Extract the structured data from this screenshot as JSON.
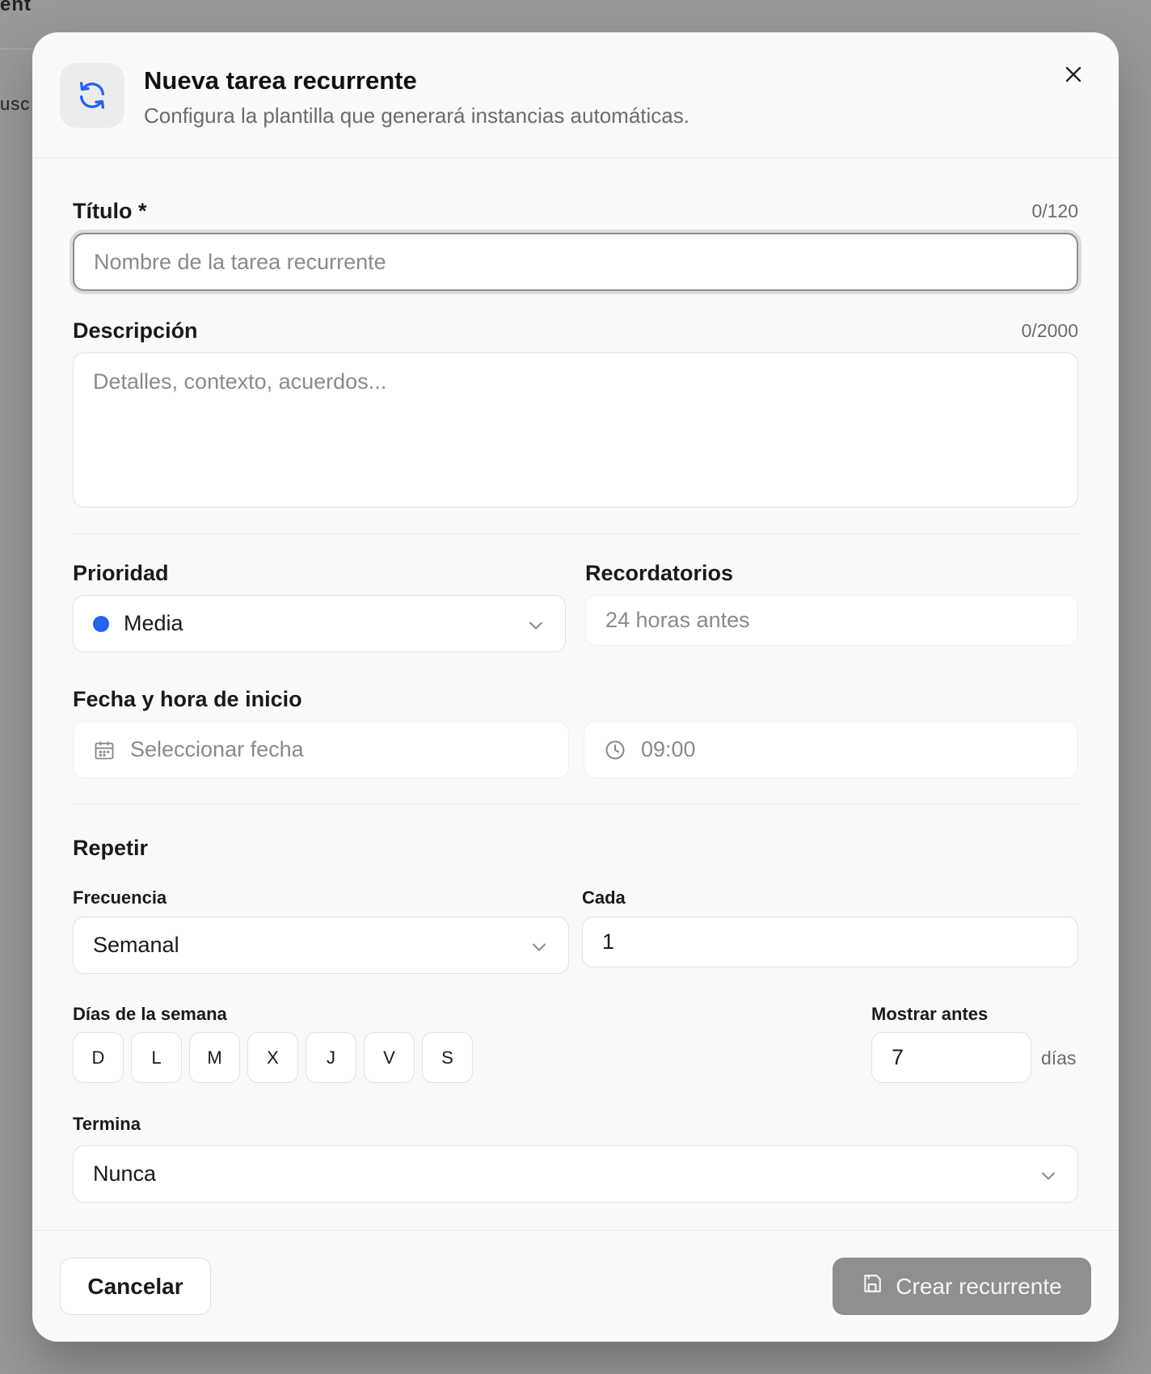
{
  "background": {
    "fragment_top": "ent",
    "fragment_mid": "usc"
  },
  "header": {
    "title": "Nueva tarea recurrente",
    "subtitle": "Configura la plantilla que generará instancias automáticas."
  },
  "titulo": {
    "label": "Título *",
    "counter": "0/120",
    "placeholder": "Nombre de la tarea recurrente"
  },
  "descripcion": {
    "label": "Descripción",
    "counter": "0/2000",
    "placeholder": "Detalles, contexto, acuerdos..."
  },
  "prioridad": {
    "label": "Prioridad",
    "value": "Media",
    "dot_color": "#2563eb"
  },
  "recordatorios": {
    "label": "Recordatorios",
    "value": "24 horas antes"
  },
  "inicio": {
    "label": "Fecha y hora de inicio",
    "date_placeholder": "Seleccionar fecha",
    "time_placeholder": "09:00"
  },
  "repetir": {
    "heading": "Repetir",
    "frecuencia_label": "Frecuencia",
    "frecuencia_value": "Semanal",
    "cada_label": "Cada",
    "cada_value": "1",
    "dias_label": "Días de la semana",
    "days": [
      "D",
      "L",
      "M",
      "X",
      "J",
      "V",
      "S"
    ],
    "mostrar_label": "Mostrar antes",
    "mostrar_value": "7",
    "mostrar_unit": "días",
    "termina_label": "Termina",
    "termina_value": "Nunca"
  },
  "footer": {
    "cancel_label": "Cancelar",
    "create_label": "Crear recurrente"
  },
  "colors": {
    "accent_blue": "#2563eb",
    "primary_button": "#8f8f8f"
  }
}
